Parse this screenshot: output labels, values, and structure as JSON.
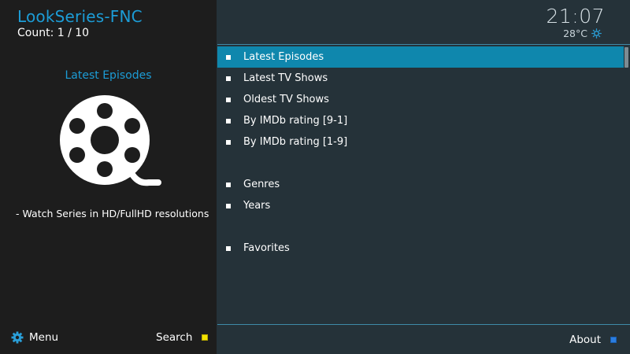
{
  "sidebar": {
    "app_title": "LookSeries-FNC",
    "count": "Count: 1 / 10",
    "selected_label": "Latest Episodes",
    "description": "- Watch Series in HD/FullHD resolutions",
    "icon": "film-reel-icon",
    "menu_label": "Menu",
    "menu_icon": "gear-icon",
    "search_label": "Search",
    "search_color": "#f2e200"
  },
  "header": {
    "time": "21:07",
    "temperature": "28°C",
    "weather_icon": "sun-icon"
  },
  "main": {
    "items": [
      {
        "label": "Latest Episodes"
      },
      {
        "label": "Latest TV Shows"
      },
      {
        "label": "Oldest TV Shows"
      },
      {
        "label": "By IMDb rating [9-1]"
      },
      {
        "label": "By IMDb rating [1-9]"
      },
      {
        "label": "Genres"
      },
      {
        "label": "Years"
      },
      {
        "label": "Favorites"
      }
    ],
    "focused_index": 0,
    "accent_color": "#0f87ad"
  },
  "footer": {
    "about_label": "About",
    "about_color": "#2b7de0"
  }
}
